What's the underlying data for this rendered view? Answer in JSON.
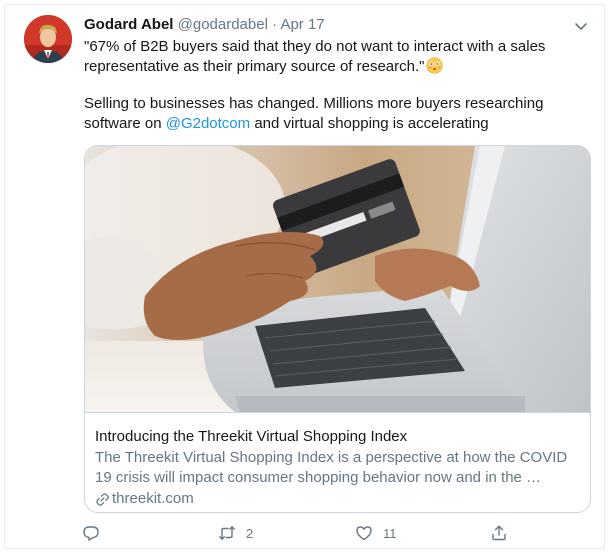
{
  "tweet": {
    "author_name": "Godard Abel",
    "handle": "@godardabel",
    "separator": " · ",
    "date": "Apr 17",
    "body": {
      "line1": "\"67% of B2B buyers said that they do not want to interact with a sales representative as their primary source of research.\"",
      "line2_before": "Selling to businesses has changed.  Millions more buyers researching software on ",
      "mention": "@G2dotcom",
      "line2_after": " and virtual shopping is accelerating",
      "emoji": "flushed-face-emoji"
    },
    "card": {
      "title": "Introducing the Threekit Virtual Shopping Index",
      "description": "The Threekit Virtual Shopping Index is a perspective at how the COVID 19 crisis will impact consumer shopping behavior now and in the …",
      "domain": "threekit.com",
      "image": "hand-holding-credit-card-laptop-photo"
    },
    "actions": {
      "reply_count": "",
      "retweet_count": "2",
      "like_count": "11"
    }
  },
  "colors": {
    "link": "#1b95e0",
    "muted": "#657786",
    "border": "#ccd6dd",
    "text": "#14171a"
  },
  "icons": [
    "chevron-down-icon",
    "reply-icon",
    "retweet-icon",
    "like-icon",
    "share-icon",
    "link-icon"
  ]
}
